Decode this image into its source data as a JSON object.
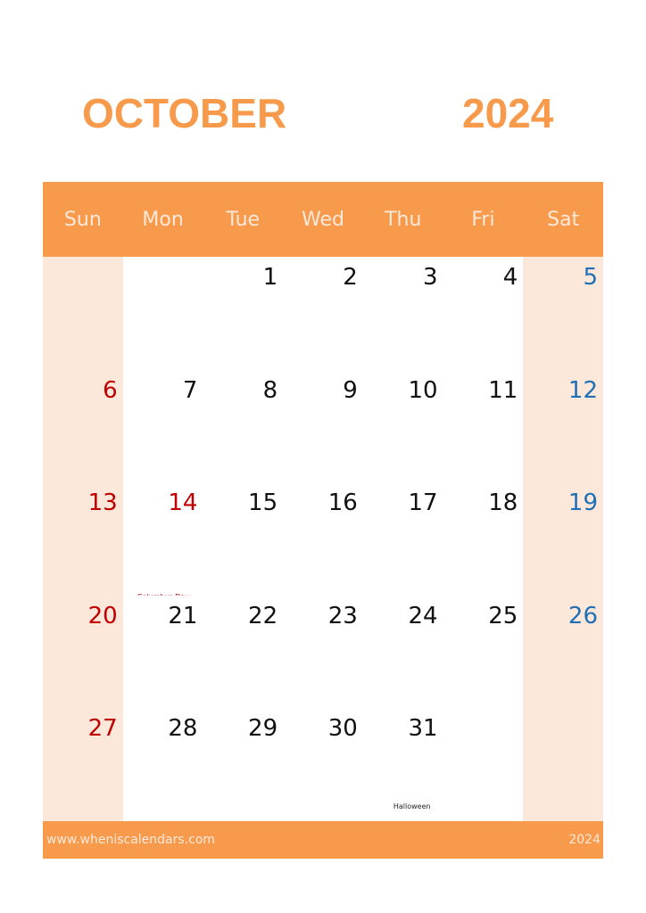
{
  "header": {
    "month": "OCTOBER",
    "year": "2024"
  },
  "weekdays": [
    "Sun",
    "Mon",
    "Tue",
    "Wed",
    "Thu",
    "Fri",
    "Sat"
  ],
  "colors": {
    "accent": "#f79a4b",
    "weekend_bg": "#fce8da",
    "sunday_holiday": "#c00000",
    "saturday": "#1f6fb5"
  },
  "weeks": [
    [
      {
        "d": ""
      },
      {
        "d": ""
      },
      {
        "d": "1"
      },
      {
        "d": "2"
      },
      {
        "d": "3"
      },
      {
        "d": "4"
      },
      {
        "d": "5",
        "c": "blue"
      }
    ],
    [
      {
        "d": "6",
        "c": "red"
      },
      {
        "d": "7"
      },
      {
        "d": "8"
      },
      {
        "d": "9"
      },
      {
        "d": "10"
      },
      {
        "d": "11"
      },
      {
        "d": "12",
        "c": "blue"
      }
    ],
    [
      {
        "d": "13",
        "c": "red"
      },
      {
        "d": "14",
        "c": "red",
        "note": "Columbus Day",
        "nt": "holiday"
      },
      {
        "d": "15"
      },
      {
        "d": "16"
      },
      {
        "d": "17"
      },
      {
        "d": "18"
      },
      {
        "d": "19",
        "c": "blue"
      }
    ],
    [
      {
        "d": "20",
        "c": "red"
      },
      {
        "d": "21"
      },
      {
        "d": "22"
      },
      {
        "d": "23"
      },
      {
        "d": "24"
      },
      {
        "d": "25"
      },
      {
        "d": "26",
        "c": "blue"
      }
    ],
    [
      {
        "d": "27",
        "c": "red"
      },
      {
        "d": "28"
      },
      {
        "d": "29"
      },
      {
        "d": "30"
      },
      {
        "d": "31",
        "note": "Halloween",
        "nt": "event"
      },
      {
        "d": ""
      },
      {
        "d": ""
      }
    ]
  ],
  "footer": {
    "website": "www.wheniscalendars.com",
    "year": "2024"
  }
}
